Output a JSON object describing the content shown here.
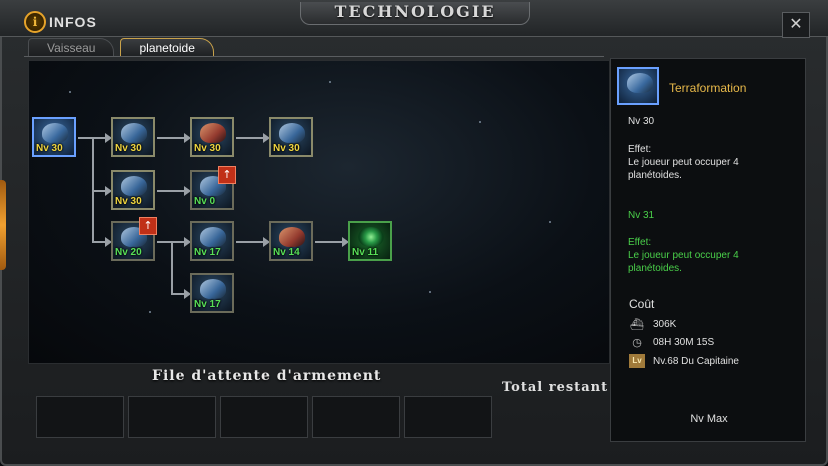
{
  "header": {
    "title": "TECHNOLOGIE",
    "infos_label": "INFOS",
    "close_glyph": "✕"
  },
  "tabs": [
    {
      "label": "Vaisseau",
      "active": false
    },
    {
      "label": "planetoide",
      "active": true
    }
  ],
  "tree": {
    "nodes": [
      {
        "id": "terraformation",
        "level": "Nv 30",
        "level_color": "yellow",
        "icon": "planet-cannon-icon"
      },
      {
        "id": "n2",
        "level": "Nv 30",
        "level_color": "yellow",
        "icon": "turret-icon"
      },
      {
        "id": "n3",
        "level": "Nv 30",
        "level_color": "yellow",
        "icon": "claw-icon"
      },
      {
        "id": "n4",
        "level": "Nv 30",
        "level_color": "yellow",
        "icon": "mech-arm-icon"
      },
      {
        "id": "n5",
        "level": "Nv 30",
        "level_color": "yellow",
        "icon": "dome-icon"
      },
      {
        "id": "n6",
        "level": "Nv 0",
        "level_color": "green",
        "icon": "planet-blue-icon",
        "upgrade": true
      },
      {
        "id": "n7",
        "level": "Nv 20",
        "level_color": "green",
        "icon": "cannon-icon",
        "upgrade": true
      },
      {
        "id": "n8",
        "level": "Nv 17",
        "level_color": "green",
        "icon": "shield-dome-icon"
      },
      {
        "id": "n9",
        "level": "Nv 14",
        "level_color": "green",
        "icon": "red-core-icon"
      },
      {
        "id": "n10",
        "level": "Nv 11",
        "level_color": "green",
        "icon": "radar-target-icon"
      },
      {
        "id": "n11",
        "level": "Nv 17",
        "level_color": "green",
        "icon": "shield-dome-icon"
      }
    ]
  },
  "queue": {
    "title": "File d'attente d'armement",
    "total_label": "Total restant"
  },
  "panel": {
    "name": "Terraformation",
    "current_level": "Nv 30",
    "effect_label": "Effet:",
    "effect_text": "Le joueur peut occuper 4 planétoides.",
    "next_level": "Nv 31",
    "next_effect_label": "Effet:",
    "next_effect_text": "Le joueur peut occuper 4 planétoides.",
    "cost_title": "Coût",
    "cost_resource": "306K",
    "cost_time": "08H 30M 15S",
    "requirement_badge": "Lv",
    "requirement": "Nv.68 Du Capitaine",
    "max_label": "Nv Max"
  },
  "colors": {
    "accent_gold": "#e8b94a",
    "level_yellow": "#f0d640",
    "level_green": "#58e058",
    "effect_green": "#4ad04a"
  }
}
